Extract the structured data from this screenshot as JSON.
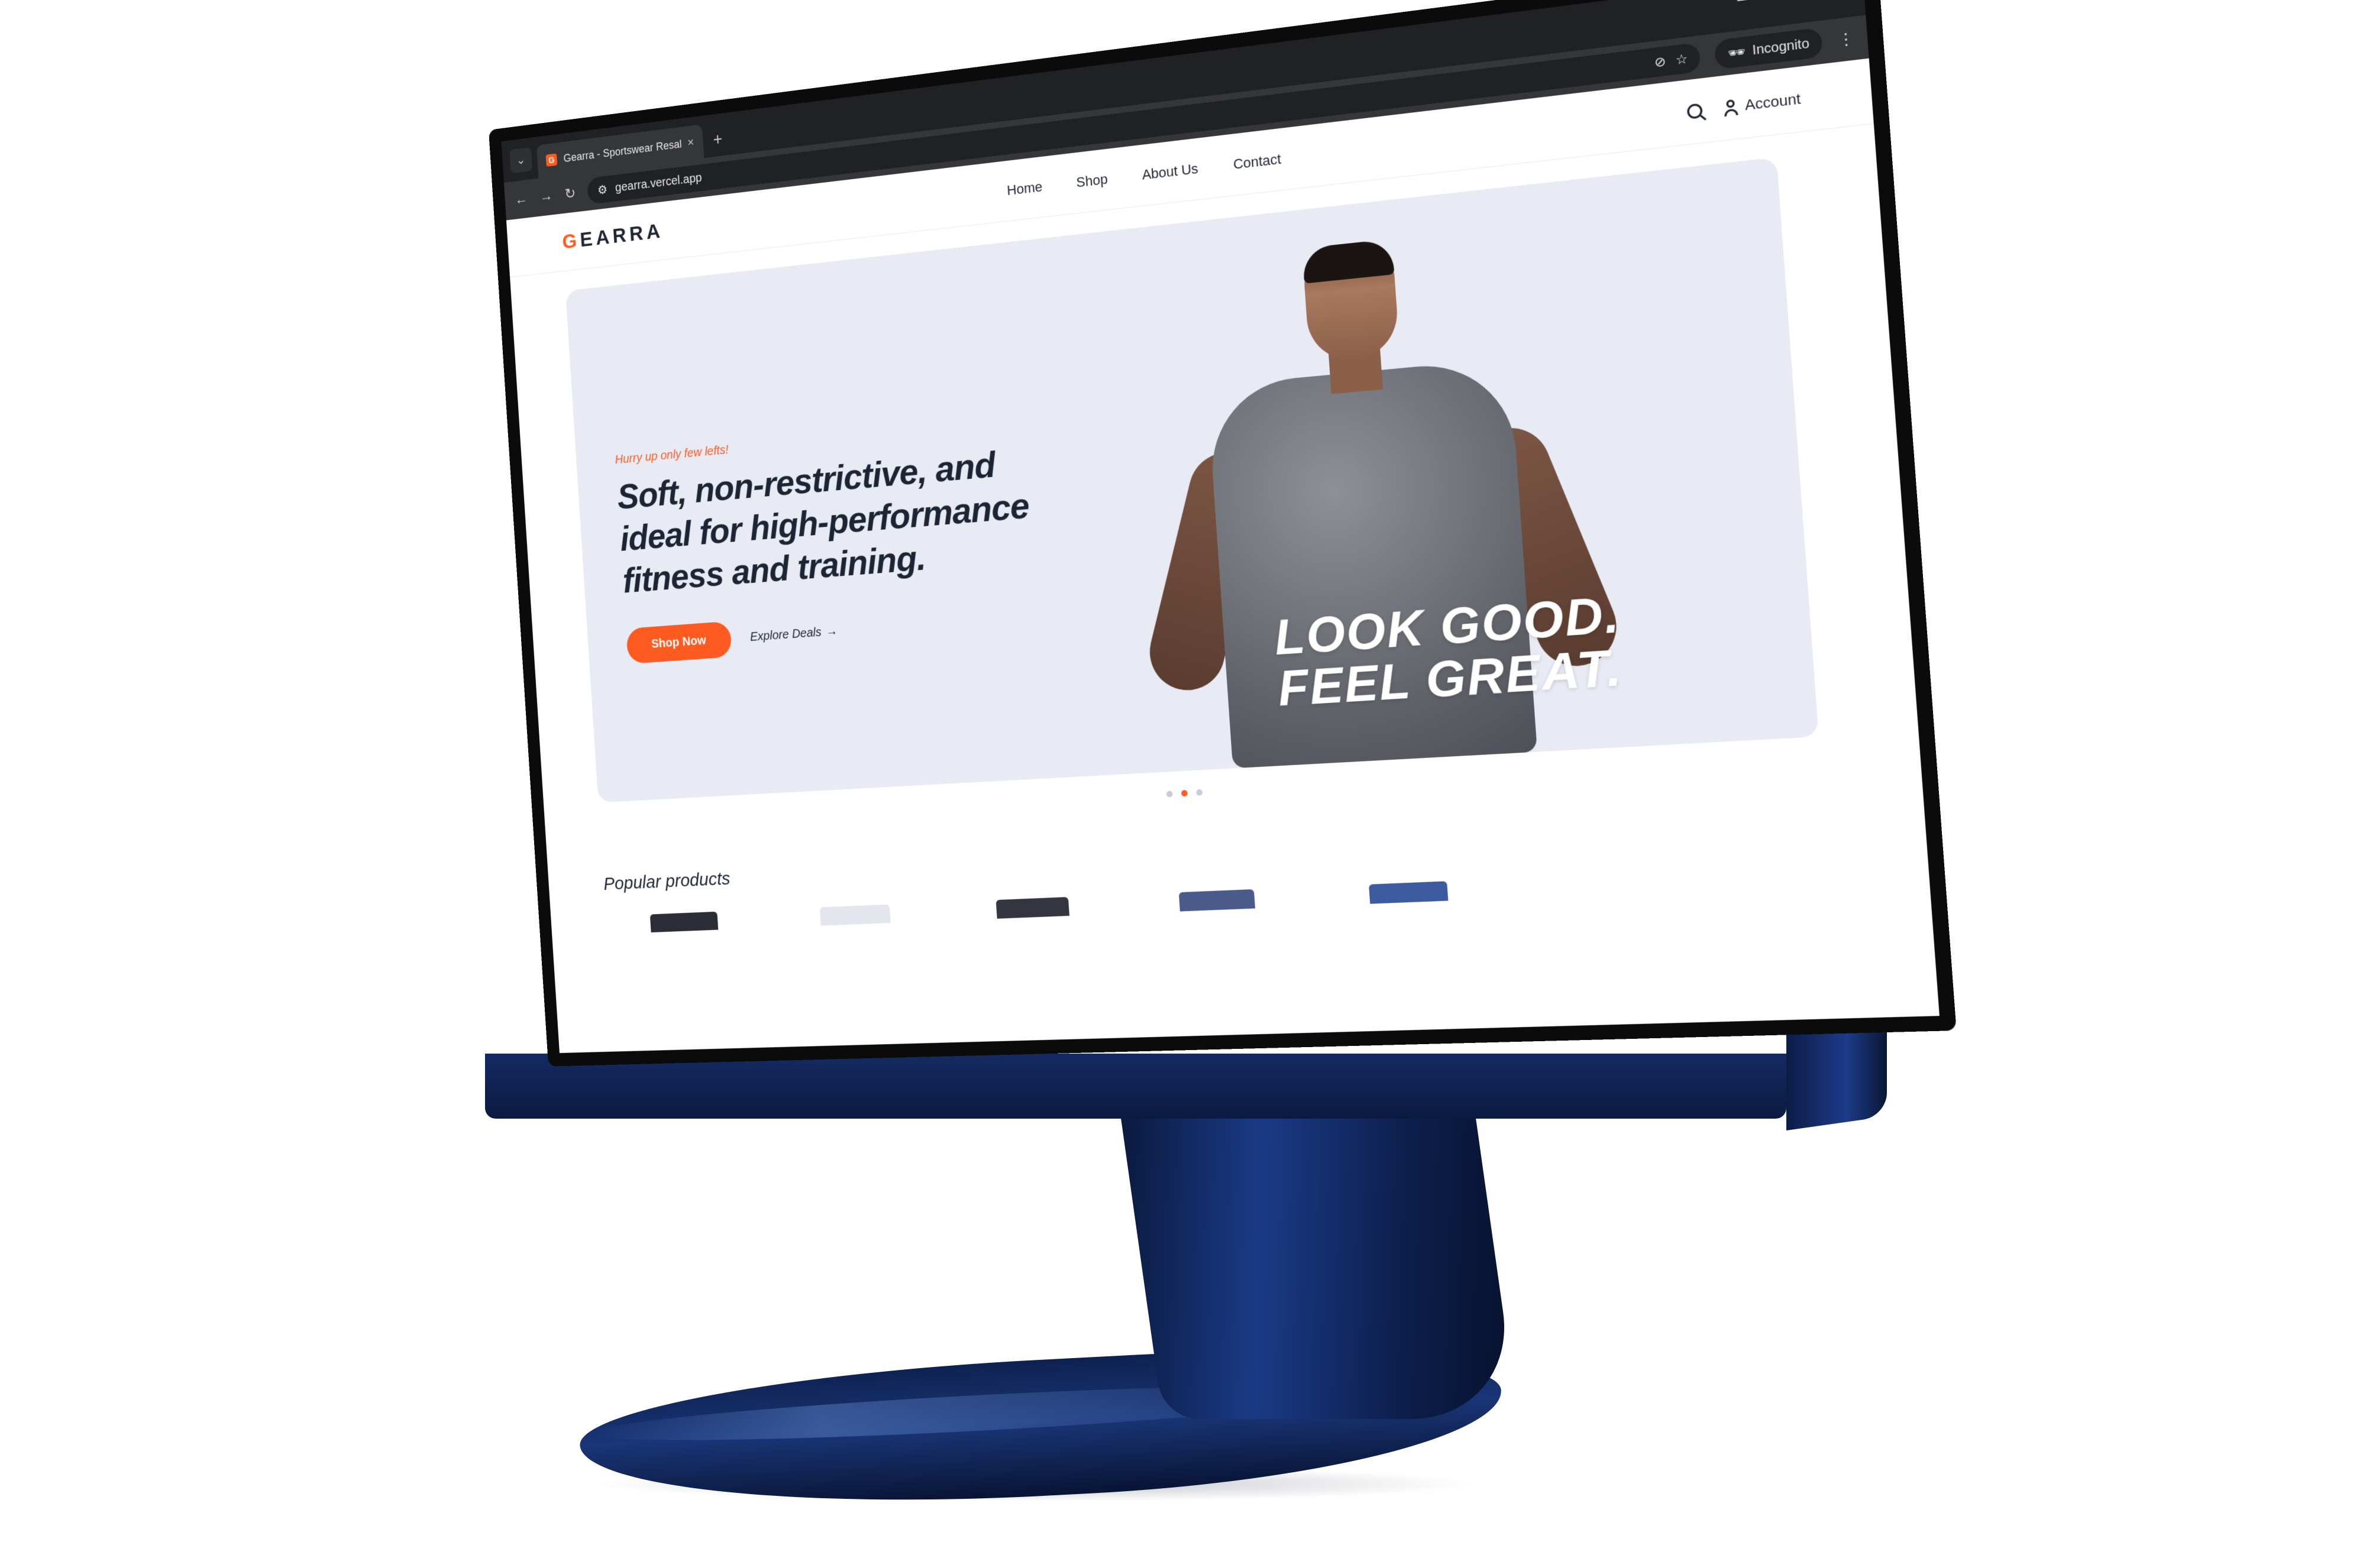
{
  "browser": {
    "tab_title": "Gearra - Sportswear Resale Hub",
    "tab_favicon": "G",
    "new_tab": "+",
    "url": "gearra.vercel.app",
    "incognito_label": "Incognito",
    "window_controls": [
      "—",
      "❐",
      "✕"
    ]
  },
  "site": {
    "logo_first": "G",
    "logo_rest": "EARRA",
    "nav": [
      "Home",
      "Shop",
      "About Us",
      "Contact"
    ],
    "account_label": "Account"
  },
  "hero": {
    "eyebrow": "Hurry up only few lefts!",
    "headline": "Soft, non-restrictive, and ideal for high-performance fitness and training.",
    "primary_cta": "Shop Now",
    "secondary_cta": "Explore Deals",
    "slogan_line1": "LOOK GOOD.",
    "slogan_line2": "FEEL GREAT.",
    "carousel_active": 2,
    "carousel_count": 3
  },
  "sections": {
    "popular_title": "Popular products"
  },
  "colors": {
    "accent": "#ff5a1f",
    "ink": "#1d2433",
    "hero_bg": "#e8ebf3",
    "chrome": "#202124"
  }
}
